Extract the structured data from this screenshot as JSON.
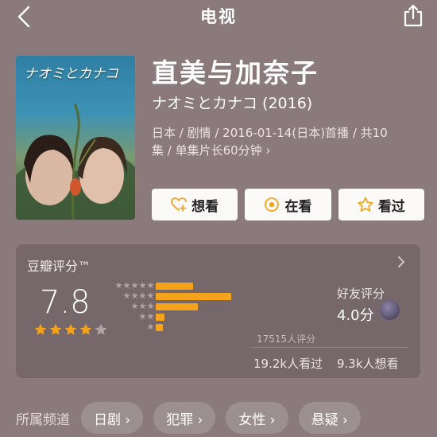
{
  "nav": {
    "title": "电视"
  },
  "poster": {
    "title": "ナオミとカナコ"
  },
  "show": {
    "title_cn": "直美与加奈子",
    "title_original": "ナオミとカナコ (2016)",
    "meta_line1": "日本 / 剧情 / 2016-01-14(日本)首播 / 共10",
    "meta_line2": "集 / 单集片长60分钟 ›"
  },
  "actions": [
    {
      "label": "想看",
      "icon": "heart-plus-icon"
    },
    {
      "label": "在看",
      "icon": "watching-icon"
    },
    {
      "label": "看过",
      "icon": "star-outline-icon"
    }
  ],
  "rating": {
    "header": "豆瓣评分™",
    "score": "7.8",
    "stars_filled": 4,
    "stars_total": 5,
    "distribution": [
      0.27,
      0.54,
      0.3,
      0.06,
      0.05
    ],
    "count_text": "17515人评分",
    "friend_label": "好友评分",
    "friend_score": "4.0分",
    "watched": "19.2k人看过",
    "wanted": "9.3k人想看",
    "accent_color": "#f6a31c"
  },
  "channels": {
    "label": "所属频道",
    "tags": [
      "日剧 ›",
      "犯罪 ›",
      "女性 ›",
      "悬疑 ›"
    ]
  }
}
